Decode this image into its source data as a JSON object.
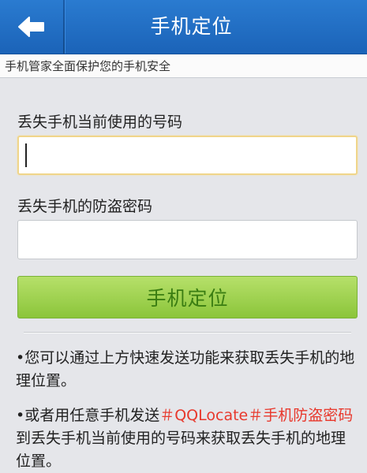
{
  "header": {
    "back_icon": "back-arrow-icon",
    "title": "手机定位"
  },
  "banner": {
    "text": "手机管家全面保护您的手机安全"
  },
  "form": {
    "phone_label": "丢失手机当前使用的号码",
    "phone_value": "",
    "password_label": "丢失手机的防盗密码",
    "password_value": "",
    "submit_label": "手机定位"
  },
  "notes": {
    "note1": "•您可以通过上方快速发送功能来获取丢失手机的地理位置。",
    "note2_prefix": "•或者用任意手机发送",
    "note2_code": "＃QQLocate＃手机防盗密码",
    "note2_suffix": "到丢失手机当前使用的号码来获取丢失手机的地理位置。"
  },
  "colors": {
    "header_bg": "#1f6cc1",
    "button_green": "#9fd153",
    "button_text": "#3a7d12",
    "highlight_red": "#e8382c"
  }
}
